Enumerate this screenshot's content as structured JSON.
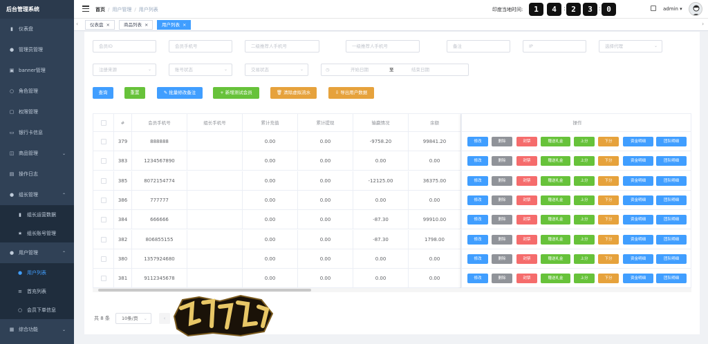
{
  "sidebar": {
    "logo": "后台管理系统",
    "items": [
      {
        "label": "仪表盘",
        "icon": "chart-icon"
      },
      {
        "label": "管理员管理",
        "icon": "user-icon"
      },
      {
        "label": "banner管理",
        "icon": "image-icon"
      },
      {
        "label": "角色管理",
        "icon": "person-icon"
      },
      {
        "label": "权限管理",
        "icon": "lock-icon"
      },
      {
        "label": "银行卡信息",
        "icon": "card-icon"
      },
      {
        "label": "商品管理",
        "icon": "shop-icon"
      },
      {
        "label": "操作日志",
        "icon": "doc-icon"
      },
      {
        "label": "组长管理",
        "icon": "user-icon"
      }
    ],
    "group_leader_sub": [
      {
        "label": "组长运营数据",
        "icon": "chart-icon"
      },
      {
        "label": "组长账号管理",
        "icon": "star-icon"
      }
    ],
    "user_mgmt": {
      "label": "用户管理",
      "icon": "user-icon"
    },
    "user_sub": [
      {
        "label": "用户列表",
        "icon": "user-icon"
      },
      {
        "label": "首充列表",
        "icon": "list-icon"
      },
      {
        "label": "会员下单信息",
        "icon": "person-icon"
      }
    ],
    "last": {
      "label": "综合功能",
      "icon": "grid-icon"
    }
  },
  "header": {
    "breadcrumb": [
      "首页",
      "用户管理",
      "用户列表"
    ],
    "clock_label": "印度当地时间:",
    "clock_digits": [
      "1",
      "4",
      "2",
      "3",
      "0"
    ],
    "user": "admin"
  },
  "tabs": [
    {
      "label": "仪表盘"
    },
    {
      "label": "商品列表"
    },
    {
      "label": "用户列表"
    }
  ],
  "filters": {
    "member_id": "会员ID",
    "member_phone": "会员手机号",
    "second_ref_phone": "二级推荐人手机号",
    "first_ref_phone": "一级推荐人手机号",
    "remark": "备注",
    "ip": "IP",
    "agent": "选择代理",
    "register_source": "注册来源",
    "account_status": "账号状态",
    "trade_status": "交易状态",
    "start_date": "开始日期",
    "date_sep": "至",
    "end_date": "结束日期"
  },
  "actions": {
    "search": "查询",
    "reset": "重置",
    "batch_remark": "批量修改备注",
    "add_test": "新增测试会员",
    "clear_flow": "清除虚拟流水",
    "export": "导出用户数据"
  },
  "table": {
    "headers": [
      "#",
      "会员手机号",
      "组长手机号",
      "累计充值",
      "累计提现",
      "输赢情况",
      "余额",
      "操作"
    ],
    "rows": [
      {
        "id": "379",
        "phone": "888888",
        "leader": "",
        "recharge": "0.00",
        "withdraw": "0.00",
        "winloss": "-9758.20",
        "balance": "99841.20"
      },
      {
        "id": "383",
        "phone": "1234567890",
        "leader": "",
        "recharge": "0.00",
        "withdraw": "0.00",
        "winloss": "0.00",
        "balance": "0.00"
      },
      {
        "id": "385",
        "phone": "8072154774",
        "leader": "",
        "recharge": "0.00",
        "withdraw": "0.00",
        "winloss": "-12125.00",
        "balance": "36375.00"
      },
      {
        "id": "386",
        "phone": "777777",
        "leader": "",
        "recharge": "0.00",
        "withdraw": "0.00",
        "winloss": "0.00",
        "balance": "0.00"
      },
      {
        "id": "384",
        "phone": "666666",
        "leader": "",
        "recharge": "0.00",
        "withdraw": "0.00",
        "winloss": "-87.30",
        "balance": "99910.00"
      },
      {
        "id": "382",
        "phone": "806855155",
        "leader": "",
        "recharge": "0.00",
        "withdraw": "0.00",
        "winloss": "-87.30",
        "balance": "1798.00"
      },
      {
        "id": "380",
        "phone": "1357924680",
        "leader": "",
        "recharge": "0.00",
        "withdraw": "0.00",
        "winloss": "0.00",
        "balance": "0.00"
      },
      {
        "id": "381",
        "phone": "9112345678",
        "leader": "",
        "recharge": "0.00",
        "withdraw": "0.00",
        "winloss": "0.00",
        "balance": "0.00"
      }
    ],
    "row_buttons": [
      {
        "label": "修改",
        "color": "#409eff"
      },
      {
        "label": "删除",
        "color": "#909399"
      },
      {
        "label": "封禁",
        "color": "#f56c6c"
      },
      {
        "label": "赠送礼金",
        "color": "#67c23a"
      },
      {
        "label": "上分",
        "color": "#67c23a"
      },
      {
        "label": "下分",
        "color": "#e6a23c"
      },
      {
        "label": "资金明细",
        "color": "#409eff"
      },
      {
        "label": "团队明细",
        "color": "#409eff"
      }
    ]
  },
  "pagination": {
    "total": "共 8 条",
    "page_size": "10条/页"
  },
  "colors": {
    "primary": "#409eff",
    "sidebar_bg": "#304156",
    "success": "#67c23a",
    "warning": "#e6a23c",
    "danger": "#f56c6c"
  }
}
